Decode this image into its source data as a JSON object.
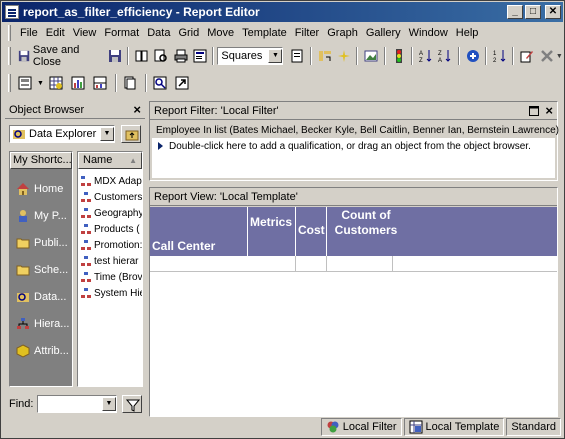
{
  "window": {
    "title": "report_as_filter_efficiency - Report Editor",
    "minimize": "_",
    "maximize": "□",
    "close": "✕"
  },
  "menu": [
    "File",
    "Edit",
    "View",
    "Format",
    "Data",
    "Grid",
    "Move",
    "Template",
    "Filter",
    "Graph",
    "Gallery",
    "Window",
    "Help"
  ],
  "toolbar": {
    "save_close": "Save and Close",
    "graph_style": "Squares"
  },
  "object_browser": {
    "title": "Object Browser",
    "close": "×",
    "source": "Data Explorer",
    "shortcuts_header": "My Shortc...",
    "shortcuts": [
      {
        "label": "Home",
        "icon": "home-icon"
      },
      {
        "label": "My P...",
        "icon": "my-personal-objects-icon"
      },
      {
        "label": "Publi...",
        "icon": "folder-icon"
      },
      {
        "label": "Sche...",
        "icon": "folder-icon"
      },
      {
        "label": "Data...",
        "icon": "data-explorer-icon"
      },
      {
        "label": "Hiera...",
        "icon": "hierarchy-icon"
      },
      {
        "label": "Attrib...",
        "icon": "attribute-icon"
      }
    ],
    "tree_header": "Name",
    "tree_items": [
      "MDX Adap",
      "Customers",
      "Geography",
      "Products (",
      "Promotion:",
      "test hierar",
      "Time (Brov",
      "System Hie"
    ],
    "find_label": "Find:",
    "find_value": ""
  },
  "report_filter": {
    "title": "Report Filter: 'Local Filter'",
    "condition": "Employee In list (Bates Michael, Becker Kyle, Bell Caitlin, Benner Ian, Bernstein Lawrence)",
    "hint": "Double-click here to add a qualification, or drag an object from the object browser."
  },
  "report_view": {
    "title": "Report View: 'Local Template'",
    "headers": [
      "Call Center",
      "Metrics",
      "Cost",
      "Count of Customers"
    ],
    "header_color": "#6f6fa3"
  },
  "status_bar": {
    "filter": "Local Filter",
    "template": "Local Template",
    "mode": "Standard"
  }
}
